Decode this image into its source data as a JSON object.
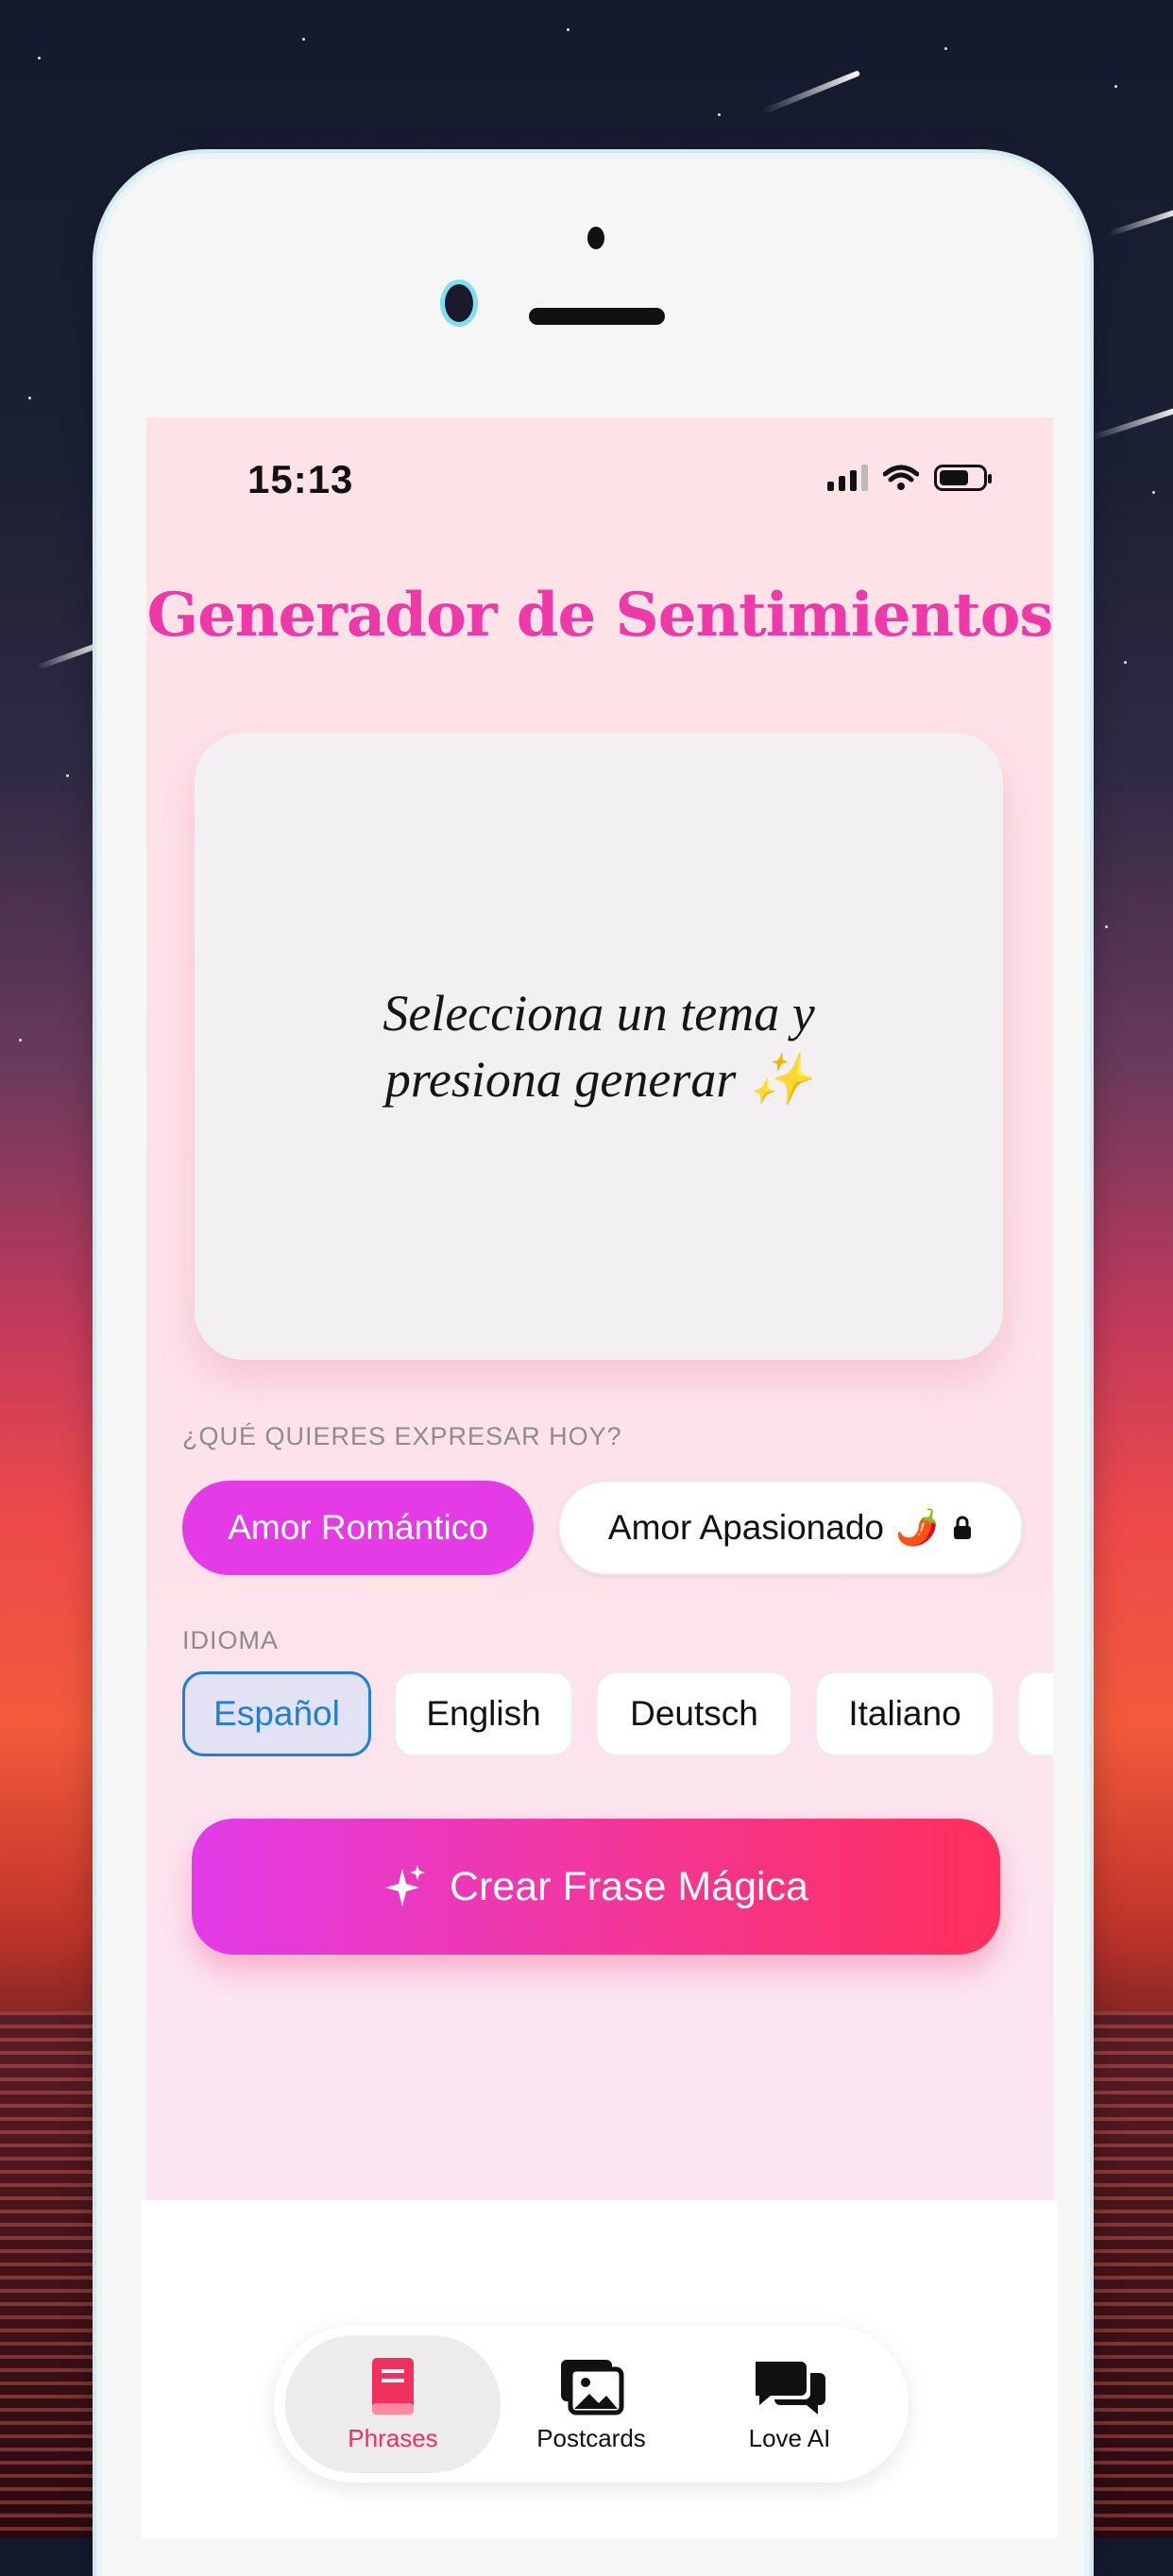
{
  "status_bar": {
    "time": "15:13"
  },
  "header": {
    "title": "Generador de Sentimientos"
  },
  "message_card": {
    "text": "Selecciona un tema y presiona generar",
    "emoji": "✨"
  },
  "topic_section": {
    "label": "¿QUÉ QUIERES EXPRESAR HOY?",
    "options": [
      {
        "label": "Amor Romántico",
        "selected": true
      },
      {
        "label": "Amor Apasionado",
        "emoji": "🌶️",
        "locked": true,
        "selected": false
      }
    ]
  },
  "language_section": {
    "label": "IDIOMA",
    "options": [
      {
        "label": "Español",
        "selected": true
      },
      {
        "label": "English",
        "selected": false
      },
      {
        "label": "Deutsch",
        "selected": false
      },
      {
        "label": "Italiano",
        "selected": false
      }
    ]
  },
  "cta": {
    "label": "Crear Frase Mágica",
    "icon": "sparkles-icon"
  },
  "tab_bar": {
    "items": [
      {
        "label": "Phrases",
        "icon": "book-icon",
        "active": true
      },
      {
        "label": "Postcards",
        "icon": "photos-icon",
        "active": false
      },
      {
        "label": "Love AI",
        "icon": "chat-bubbles-icon",
        "active": false
      }
    ]
  },
  "colors": {
    "accent_pink": "#ee3aa8",
    "cta_start": "#e23be8",
    "cta_end": "#ff2f5c",
    "language_selected": "#1e7fd6",
    "tab_active": "#f2305e"
  }
}
